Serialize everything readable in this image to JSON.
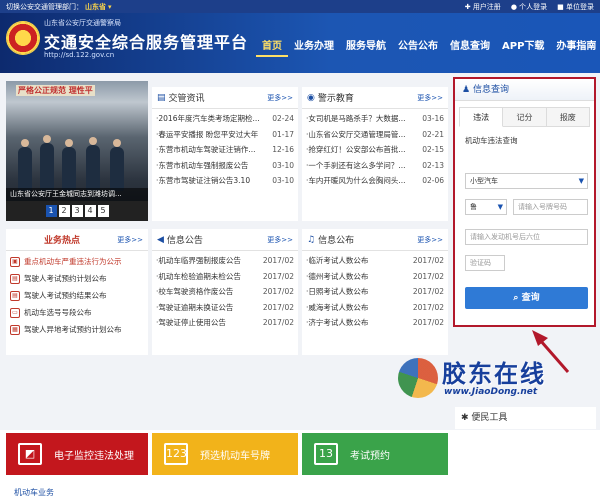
{
  "topbar": {
    "switch_label": "切换公安交通管理部门：",
    "region": "山东省",
    "links": [
      "用户注册",
      "个人登录",
      "单位登录"
    ]
  },
  "header": {
    "org": "山东省公安厅交通警察局",
    "title": "交通安全综合服务管理平台",
    "url": "http://sd.122.gov.cn",
    "nav": [
      "首页",
      "业务办理",
      "服务导航",
      "公告公布",
      "信息查询",
      "APP下载",
      "办事指南"
    ],
    "active_nav": "首页"
  },
  "carousel": {
    "banner": "严格公正规范  理性平",
    "caption": "山东省公安厅王金城同志到潍坊调...",
    "pages": [
      "1",
      "2",
      "3",
      "4",
      "5"
    ],
    "active_page": "1"
  },
  "news": {
    "title": "交管资讯",
    "more": "更多>>",
    "items": [
      {
        "t": "2016年度汽车类考场定期检...",
        "d": "02-24"
      },
      {
        "t": "春运平安播报 盼您平安过大年",
        "d": "01-17"
      },
      {
        "t": "东营市机动车驾驶证注销作...",
        "d": "12-16"
      },
      {
        "t": "东营市机动车强制报废公告",
        "d": "03-10"
      },
      {
        "t": "东营市驾驶证注销公告3.10",
        "d": "03-10"
      }
    ]
  },
  "warning": {
    "title": "警示教育",
    "more": "更多>>",
    "items": [
      {
        "t": "女司机是马路杀手？大数据...",
        "d": "03-16"
      },
      {
        "t": "山东省公安厅交通管理局管...",
        "d": "02-21"
      },
      {
        "t": "抢穿红灯！公安部公布首批...",
        "d": "02-15"
      },
      {
        "t": "一个手刹还有这么多学问？...",
        "d": "02-13"
      },
      {
        "t": "车内开暖风为什么会胸闷头...",
        "d": "02-06"
      }
    ]
  },
  "hotspot": {
    "title": "业务热点",
    "more": "更多>>",
    "items": [
      "重点机动车严重违法行为公示",
      "驾驶人考试预约计划公布",
      "驾驶人考试预约结果公布",
      "机动车选号号段公布",
      "驾驶人异地考试预约计划公布"
    ]
  },
  "notice": {
    "title": "信息公告",
    "more": "更多>>",
    "items": [
      {
        "t": "机动车临界强制报废公告",
        "d": "2017/02"
      },
      {
        "t": "机动车检验逾期未检公告",
        "d": "2017/02"
      },
      {
        "t": "校车驾驶资格作废公告",
        "d": "2017/02"
      },
      {
        "t": "驾驶证逾期未换证公告",
        "d": "2017/02"
      },
      {
        "t": "驾驶证停止使用公告",
        "d": "2017/02"
      }
    ]
  },
  "info": {
    "title": "信息公布",
    "more": "更多>>",
    "items": [
      {
        "t": "临沂考试人数公布",
        "d": "2017/02"
      },
      {
        "t": "德州考试人数公布",
        "d": "2017/02"
      },
      {
        "t": "日照考试人数公布",
        "d": "2017/02"
      },
      {
        "t": "威海考试人数公布",
        "d": "2017/02"
      },
      {
        "t": "济宁考试人数公布",
        "d": "2017/02"
      }
    ]
  },
  "query": {
    "title": "信息查询",
    "tabs": [
      "违法",
      "记分",
      "报废"
    ],
    "active_tab": "违法",
    "section": "机动车违法查询",
    "vehicle_type": "小型汽车",
    "province": "鲁",
    "plate_placeholder": "请输入号牌号码",
    "engine_placeholder": "请输入发动机号后六位",
    "captcha_placeholder": "验证码",
    "button": "查询"
  },
  "convenience": {
    "title": "便民工具"
  },
  "strips": [
    {
      "label": "电子监控违法处理",
      "color": "#c3171d"
    },
    {
      "label": "预选机动车号牌",
      "color": "#f2b31a"
    },
    {
      "label": "考试预约",
      "color": "#3aa34a"
    }
  ],
  "bottom": {
    "label": "机动车业务"
  },
  "watermark": {
    "text": "胶东在线",
    "url": "www.JiaoDong.net"
  },
  "colors": {
    "brand": "#1c56b3",
    "accent": "#b2182b",
    "button": "#2f7ad6"
  }
}
